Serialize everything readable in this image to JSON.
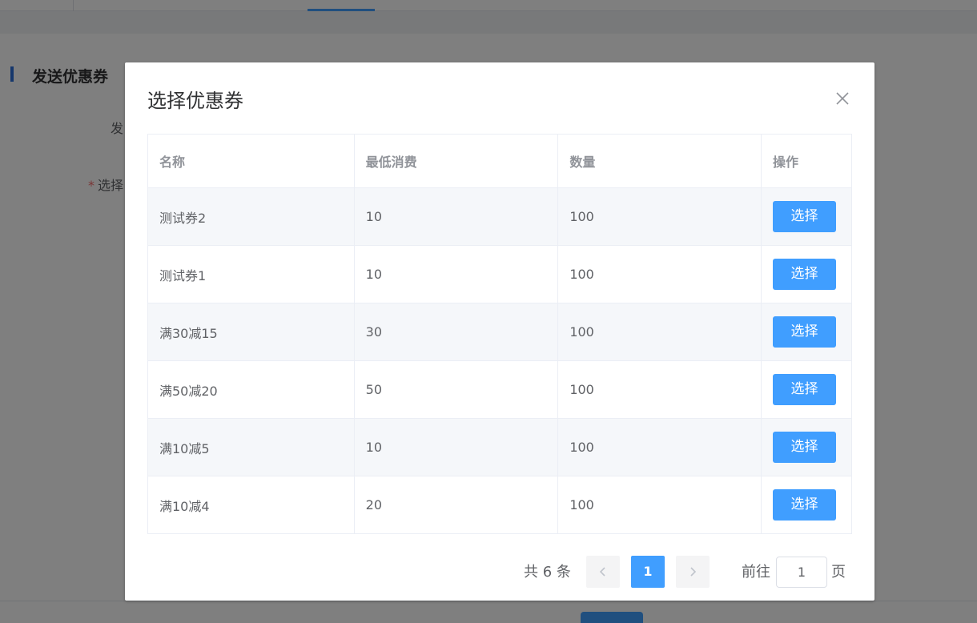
{
  "background": {
    "section_title": "发送优惠券",
    "label_send": "发",
    "label_select_required": "*",
    "label_select": "选择"
  },
  "dialog": {
    "title": "选择优惠券",
    "close_icon": "close-icon",
    "table": {
      "columns": [
        "名称",
        "最低消费",
        "数量",
        "操作"
      ],
      "rows": [
        {
          "name": "测试券2",
          "min_spend": "10",
          "quantity": "100",
          "action": "选择"
        },
        {
          "name": "测试券1",
          "min_spend": "10",
          "quantity": "100",
          "action": "选择"
        },
        {
          "name": "满30减15",
          "min_spend": "30",
          "quantity": "100",
          "action": "选择"
        },
        {
          "name": "满50减20",
          "min_spend": "50",
          "quantity": "100",
          "action": "选择"
        },
        {
          "name": "满10减5",
          "min_spend": "10",
          "quantity": "100",
          "action": "选择"
        },
        {
          "name": "满10减4",
          "min_spend": "20",
          "quantity": "100",
          "action": "选择"
        }
      ]
    },
    "pagination": {
      "total_text": "共 6 条",
      "current_page": "1",
      "goto_label": "前往",
      "goto_value": "1",
      "goto_suffix": "页"
    }
  },
  "colors": {
    "primary": "#409eff",
    "stripe": "#f5f7fa",
    "border": "#ebeef5",
    "section_accent": "#2d6fd8",
    "required": "#f56c6c"
  }
}
